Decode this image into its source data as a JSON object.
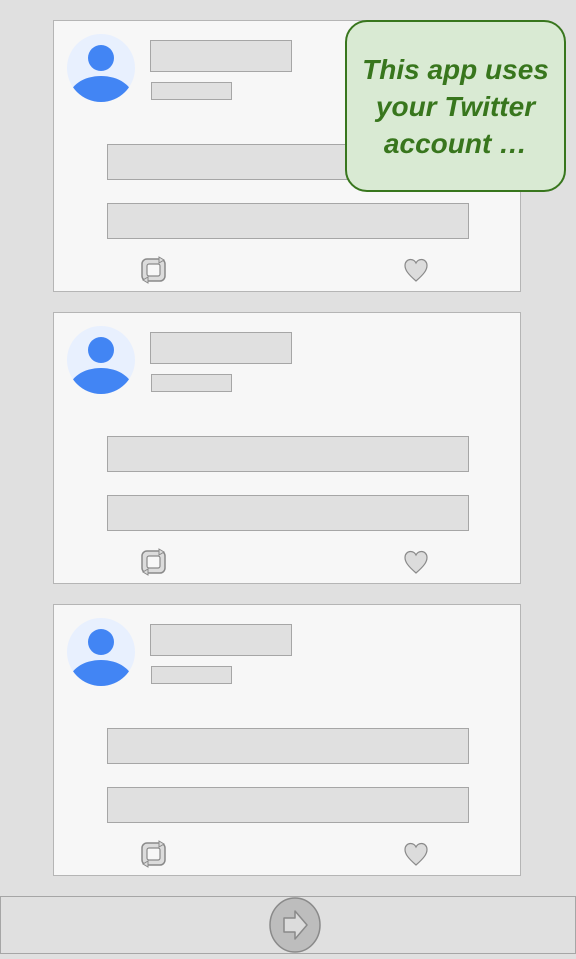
{
  "tooltip": {
    "text": "This app uses your Twitter account …"
  },
  "feed": {
    "cards": [
      {
        "id": "tweet-1"
      },
      {
        "id": "tweet-2"
      },
      {
        "id": "tweet-3"
      }
    ]
  },
  "icons": {
    "avatar": "user-avatar-icon",
    "retweet": "retweet-icon",
    "like": "heart-icon",
    "next": "arrow-right-icon"
  },
  "colors": {
    "background": "#e0e0e0",
    "card": "#f7f7f7",
    "avatar_bg": "#e8f0fe",
    "avatar_fg": "#4285f4",
    "tooltip_bg": "#d9ead3",
    "tooltip_border": "#38761d",
    "tooltip_text": "#38761d"
  }
}
